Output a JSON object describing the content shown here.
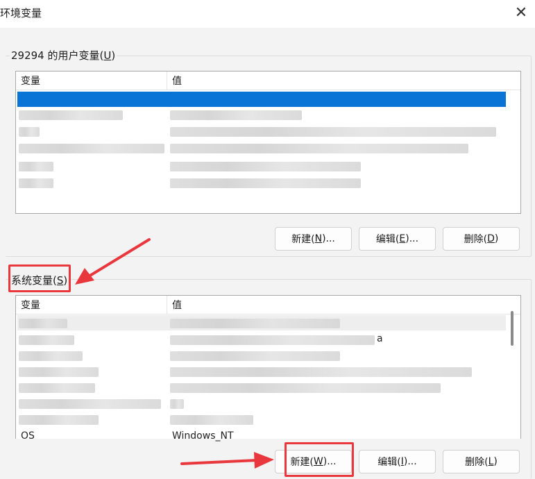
{
  "window": {
    "title": "环境变量",
    "close_glyph": "✕"
  },
  "user_group": {
    "title_prefix": "29294 的用户变量(",
    "title_accel": "U",
    "title_suffix": ")",
    "col_var": "变量",
    "col_val": "值",
    "buttons": {
      "new_prefix": "新建(",
      "new_accel": "N",
      "new_suffix": ")...",
      "edit_prefix": "编辑(",
      "edit_accel": "E",
      "edit_suffix": ")...",
      "delete_prefix": "删除(",
      "delete_accel": "D",
      "delete_suffix": ")"
    }
  },
  "system_group": {
    "title_prefix": "系统变量(",
    "title_accel": "S",
    "title_suffix": ")",
    "col_var": "变量",
    "col_val": "值",
    "visible_tail_a": "a",
    "last_row_var": "OS",
    "last_row_val": "Windows_NT",
    "buttons": {
      "new_prefix": "新建(",
      "new_accel": "W",
      "new_suffix": ")...",
      "edit_prefix": "编辑(",
      "edit_accel": "I",
      "edit_suffix": ")...",
      "delete_prefix": "删除(",
      "delete_accel": "L",
      "delete_suffix": ")"
    }
  },
  "colors": {
    "selection": "#0a74d6",
    "annotation": "#e8383d"
  },
  "icons": [
    "close-icon",
    "annotation-arrow-icon"
  ]
}
